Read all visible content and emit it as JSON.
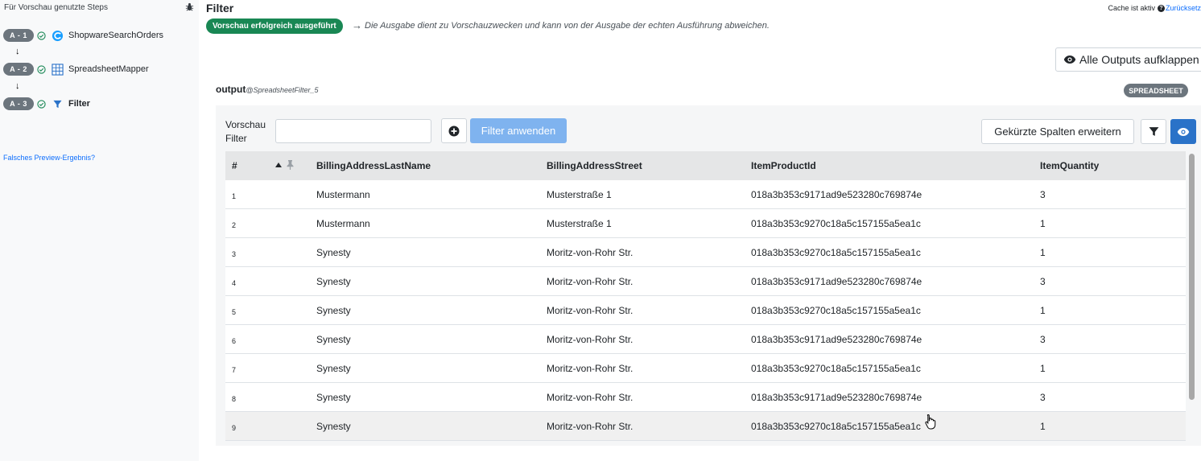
{
  "sidebar": {
    "title": "Für Vorschau genutzte Steps",
    "steps": [
      {
        "badge": "A - 1",
        "label": "ShopwareSearchOrders",
        "icon": "shopware-icon"
      },
      {
        "badge": "A - 2",
        "label": "SpreadsheetMapper",
        "icon": "spreadsheet-icon"
      },
      {
        "badge": "A - 3",
        "label": "Filter",
        "icon": "filter-icon"
      }
    ],
    "false_result_link": "Falsches Preview-Ergebnis?"
  },
  "header": {
    "title": "Filter",
    "cache_text": "Cache ist aktiv",
    "reset_link": "Zurücksetz",
    "success_badge": "Vorschau erfolgreich ausgeführt",
    "info_text": "Die Ausgabe dient zu Vorschauzwecken und kann von der Ausgabe der echten Ausführung abweichen.",
    "expand_all": "Alle Outputs aufklappen"
  },
  "output": {
    "name": "output",
    "source": "@SpreadsheetFilter_5",
    "type_badge": "SPREADSHEET"
  },
  "toolbar": {
    "filter_label_line1": "Vorschau",
    "filter_label_line2": "Filter",
    "filter_value": "",
    "apply_label": "Filter anwenden",
    "shorten_label": "Gekürzte Spalten erweitern"
  },
  "table": {
    "columns": [
      "#",
      "BillingAddressLastName",
      "BillingAddressStreet",
      "ItemProductId",
      "ItemQuantity"
    ],
    "rows": [
      [
        "1",
        "Mustermann",
        "Musterstraße 1",
        "018a3b353c9171ad9e523280c769874e",
        "3"
      ],
      [
        "2",
        "Mustermann",
        "Musterstraße 1",
        "018a3b353c9270c18a5c157155a5ea1c",
        "1"
      ],
      [
        "3",
        "Synesty",
        "Moritz-von-Rohr Str.",
        "018a3b353c9270c18a5c157155a5ea1c",
        "1"
      ],
      [
        "4",
        "Synesty",
        "Moritz-von-Rohr Str.",
        "018a3b353c9171ad9e523280c769874e",
        "3"
      ],
      [
        "5",
        "Synesty",
        "Moritz-von-Rohr Str.",
        "018a3b353c9270c18a5c157155a5ea1c",
        "1"
      ],
      [
        "6",
        "Synesty",
        "Moritz-von-Rohr Str.",
        "018a3b353c9171ad9e523280c769874e",
        "3"
      ],
      [
        "7",
        "Synesty",
        "Moritz-von-Rohr Str.",
        "018a3b353c9270c18a5c157155a5ea1c",
        "1"
      ],
      [
        "8",
        "Synesty",
        "Moritz-von-Rohr Str.",
        "018a3b353c9171ad9e523280c769874e",
        "3"
      ],
      [
        "9",
        "Synesty",
        "Moritz-von-Rohr Str.",
        "018a3b353c9270c18a5c157155a5ea1c",
        "1"
      ]
    ]
  },
  "colors": {
    "success": "#198754",
    "primary": "#2a72c8",
    "apply_button": "#7fb3ef",
    "badge_gray": "#6c757d",
    "link": "#0d6efd"
  }
}
